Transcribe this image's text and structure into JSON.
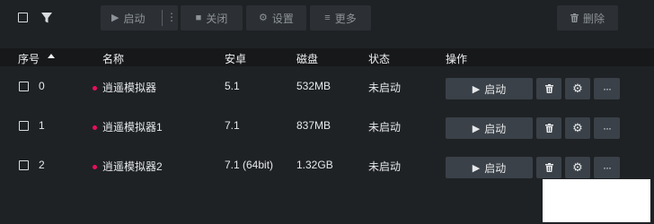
{
  "toolbar": {
    "start_label": "启动",
    "close_label": "关闭",
    "settings_label": "设置",
    "more_label": "更多",
    "delete_label": "删除"
  },
  "columns": {
    "index": "序号",
    "name": "名称",
    "android": "安卓",
    "disk": "磁盘",
    "status": "状态",
    "actions": "操作"
  },
  "rows": [
    {
      "index": "0",
      "name": "逍遥模拟器",
      "android": "5.1",
      "disk": "532MB",
      "status": "未启动",
      "start_label": "启动"
    },
    {
      "index": "1",
      "name": "逍遥模拟器1",
      "android": "7.1",
      "disk": "837MB",
      "status": "未启动",
      "start_label": "启动"
    },
    {
      "index": "2",
      "name": "逍遥模拟器2",
      "android": "7.1 (64bit)",
      "disk": "1.32GB",
      "status": "未启动",
      "start_label": "启动"
    }
  ],
  "colors": {
    "background": "#1f2225",
    "header_background": "#16181a",
    "toolbar_button": "#2c3034",
    "action_button": "#3a4148",
    "status_dot": "#e8105a"
  },
  "icons": [
    "select-all-checkbox",
    "filter-icon",
    "play-icon",
    "stop-icon",
    "gear-icon",
    "menu-icon",
    "trash-icon",
    "sort-asc-icon",
    "dots-icon"
  ]
}
